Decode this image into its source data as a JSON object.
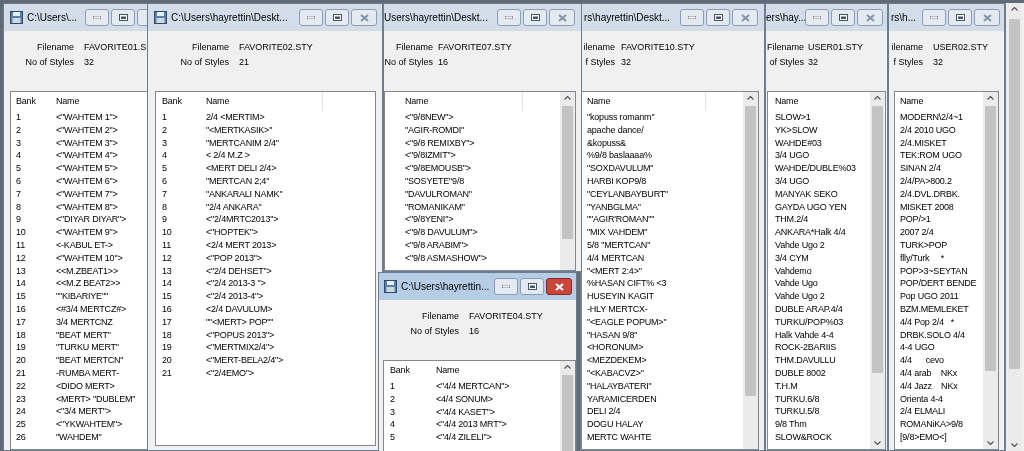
{
  "windows": [
    {
      "title": "C:\\Users\\...",
      "active": false,
      "filename_label": "Filename",
      "filename": "FAVORITE01.S",
      "styles_label": "No of Styles",
      "styles": "32",
      "columns": [
        "Bank",
        "Name"
      ],
      "rows": [
        [
          "1",
          "<\"WAHTEM 1\">"
        ],
        [
          "2",
          "<\"WAHTEM 2\">"
        ],
        [
          "3",
          "<\"WAHTEM 3\">"
        ],
        [
          "4",
          "<\"WAHTEM 4\">"
        ],
        [
          "5",
          "<\"WAHTEM 5\">"
        ],
        [
          "6",
          "<\"WAHTEM 6\">"
        ],
        [
          "7",
          "<\"WAHTEM 7\">"
        ],
        [
          "8",
          "<\"WAHTEM 8\">"
        ],
        [
          "9",
          "<\"DIYAR DIYAR\">"
        ],
        [
          "10",
          "<\"WAHTEM 9\">"
        ],
        [
          "11",
          "<-KABUL ET->"
        ],
        [
          "12",
          "<\"WAHTEM 10\">"
        ],
        [
          "13",
          "<<M.ZBEAT1>>"
        ],
        [
          "14",
          "<<M.Z BEAT2>>"
        ],
        [
          "15",
          "\"\"KIBARIYE\"\""
        ],
        [
          "16",
          "<#3/4 MERTCZ#>"
        ],
        [
          "17",
          "3/4 MERTCNZ"
        ],
        [
          "18",
          "\"BEAT MERT\""
        ],
        [
          "19",
          "\"TURKU MERT\""
        ],
        [
          "20",
          "\"BEAT MERTCN\""
        ],
        [
          "21",
          "-RUMBA MERT-"
        ],
        [
          "22",
          "<DIDO MERT>"
        ],
        [
          "23",
          "<MERT> \"DUBLEM\""
        ],
        [
          "24",
          "<\"3/4 MERT\">"
        ],
        [
          "25",
          "<\"YKWAHTEM\">"
        ],
        [
          "26",
          "\"WAHDEM\""
        ]
      ]
    },
    {
      "title": "C:\\Users\\hayrettin\\Deskt...",
      "active": false,
      "filename_label": "Filename",
      "filename": "FAVORITE02.STY",
      "styles_label": "No of Styles",
      "styles": "21",
      "columns": [
        "Bank",
        "Name"
      ],
      "rows": [
        [
          "1",
          "2/4 <MERTIM>"
        ],
        [
          "2",
          "\"<MERTKASIK>\""
        ],
        [
          "3",
          "\"MERTCANIM 2/4\""
        ],
        [
          "4",
          "< 2/4 M.Z >"
        ],
        [
          "5",
          "<MERT DELI 2/4>"
        ],
        [
          "6",
          "\"MERTCAN 2;4\""
        ],
        [
          "7",
          "\"ANKARALI NAMK\""
        ],
        [
          "8",
          "\"2/4 ANKARA\""
        ],
        [
          "9",
          "<\"2/4MRTC2013\">"
        ],
        [
          "10",
          "<\"HOPTEK\">"
        ],
        [
          "11",
          "<2/4 MERT 2013>"
        ],
        [
          "12",
          "<\"POP 2013\">"
        ],
        [
          "13",
          "<\"2/4 DEHSET\">"
        ],
        [
          "14",
          "<\"2/4 2013-3 \">"
        ],
        [
          "15",
          "<\"2/4 2013-4\">"
        ],
        [
          "16",
          "<2/4 DAVULUM>"
        ],
        [
          "17",
          "\"\"<MERT> POP\"\""
        ],
        [
          "18",
          "<\"POPUS 2013\">"
        ],
        [
          "19",
          "<\"MERTMIX2/4\">"
        ],
        [
          "20",
          "<\"MERT-BELA2/4\">"
        ],
        [
          "21",
          "<\"2/4EMO\">"
        ]
      ]
    },
    {
      "title": "Users\\hayrettin\\Deskt...",
      "active": false,
      "filename_label": "Filename",
      "filename": "FAVORITE07.STY",
      "styles_label": "No of Styles",
      "styles": "16",
      "columns": [
        "Name"
      ],
      "rows": [
        [
          "<\"9/8NEW\">"
        ],
        [
          "\"AGIR-ROMDI\""
        ],
        [
          "<\"9/8 REMIXBY\">"
        ],
        [
          "<\"9/8IZMIT\">"
        ],
        [
          "<\"9/8EMOUSB\">"
        ],
        [
          "\"SOSYETE\"9/8"
        ],
        [
          "\"DAVULROMAN\""
        ],
        [
          "\"ROMANIKAM\""
        ],
        [
          "<\"9/8YENI\">"
        ],
        [
          "<\"9/8 DAVULUM\">"
        ],
        [
          "<\"9/8 ARABIM\">"
        ],
        [
          "<\"9/8 ASMASHOW\">"
        ]
      ]
    },
    {
      "title": "C:\\Users\\hayrettin...",
      "active": true,
      "filename_label": "Filename",
      "filename": "FAVORITE04.STY",
      "styles_label": "No of Styles",
      "styles": "16",
      "columns": [
        "Bank",
        "Name"
      ],
      "rows": [
        [
          "1",
          "<\"4/4 MERTCAN\">"
        ],
        [
          "2",
          "<4/4 SONUM>"
        ],
        [
          "3",
          "<\"4/4 KASET\">"
        ],
        [
          "4",
          "<\"4/4 2013 MRT\">"
        ],
        [
          "5",
          "<\"4/4 ZILELI\">"
        ]
      ]
    },
    {
      "title": "rs\\hayrettin\\Deskt...",
      "active": false,
      "filename_label": "ilename",
      "filename": "FAVORITE10.STY",
      "styles_label": "f Styles",
      "styles": "32",
      "columns": [
        "Name"
      ],
      "rows": [
        [
          "\"kopuss romanm\""
        ],
        [
          "apache dance/"
        ],
        [
          "&kopuss&"
        ],
        [
          "%9/8 baslaaaa%"
        ],
        [
          "\"SOXDAVULUM\""
        ],
        [
          "HARBI KOP9/8"
        ],
        [
          "\"CEYLANBAYBURT\""
        ],
        [
          "\"YANBGLMA\""
        ],
        [
          "\"\"AGIR'ROMAN\"\""
        ],
        [
          "\"MIX VAHDEM\""
        ],
        [
          "5/8 \"MERTCAN\""
        ],
        [
          "4/4 MERTCAN"
        ],
        [
          "\"<MERT 2:4>\""
        ],
        [
          "%HASAN CIFT% <3"
        ],
        [
          "HUSEYIN KAGIT"
        ],
        [
          "-HLY MERTCX-"
        ],
        [
          "\"<EAGLE POPUM>\""
        ],
        [
          "\"HASAN 9/8\""
        ],
        [
          "<HORONUM>"
        ],
        [
          "<MEZDEKEM>"
        ],
        [
          "\"<KABACVZ>\""
        ],
        [
          "\"HALAYBATERI\""
        ],
        [
          "YARAMICERDEN"
        ],
        [
          "DELI 2/4"
        ],
        [
          "DOGU HALAY"
        ],
        [
          "MERTC WAHTE"
        ]
      ]
    },
    {
      "title": "ers\\hay...",
      "active": false,
      "filename_label": "Filename",
      "filename": "USER01.STY",
      "styles_label": "of Styles",
      "styles": "32",
      "columns": [
        "Name"
      ],
      "rows": [
        [
          "SLOW>1"
        ],
        [
          "YK>SLOW"
        ],
        [
          "WAHDE#03"
        ],
        [
          "3/4 UGO"
        ],
        [
          "WAHDE/DUBLE%03"
        ],
        [
          "3/4 UGO"
        ],
        [
          "MANYAK SEKO"
        ],
        [
          "GAYDA UGO YEN"
        ],
        [
          "THM.2/4"
        ],
        [
          "ANKARA*Halk 4/4"
        ],
        [
          "Vahde Ugo 2"
        ],
        [
          "3/4 CYM"
        ],
        [
          "Vahdemo"
        ],
        [
          "Vahde Ugo"
        ],
        [
          "Vahde Ugo 2"
        ],
        [
          "DUBLE ARAP.4/4"
        ],
        [
          "TURKU/POP%03"
        ],
        [
          "Halk Vahde 4-4"
        ],
        [
          "ROCK-2BARIIS"
        ],
        [
          "THM.DAVULLU"
        ],
        [
          "DUBLE 8002"
        ],
        [
          "T.H.M"
        ],
        [
          "TURKU.6/8"
        ],
        [
          "TURKU.5/8"
        ],
        [
          "9/8 Thm"
        ],
        [
          "SLOW&ROCK"
        ]
      ]
    },
    {
      "title": "rs\\h...",
      "active": false,
      "filename_label": "ilename",
      "filename": "USER02.STY",
      "styles_label": "f Styles",
      "styles": "32",
      "columns": [
        "Name"
      ],
      "rows": [
        [
          "MODERN\\2/4~1"
        ],
        [
          "2/4 2010 UGO"
        ],
        [
          "2/4.MISKET"
        ],
        [
          "TEK:ROM UGO"
        ],
        [
          "SINAN 2/4"
        ],
        [
          "2/4/PA>800.2"
        ],
        [
          "2/4.DVL.DRBK."
        ],
        [
          "MISKET 2008"
        ],
        [
          "POP/>1"
        ],
        [
          "2007 2/4"
        ],
        [
          "TURK>POP"
        ],
        [
          "flly/Turk     *"
        ],
        [
          "POP>3~SEYTAN"
        ],
        [
          "POP/DERT BENDE"
        ],
        [
          "Pop UGO 2011"
        ],
        [
          "BZM.MEMLEKET"
        ],
        [
          "4/4 Pop 2/4   *"
        ],
        [
          "DRBK.SOLO 4/4"
        ],
        [
          "4-4 UGO"
        ],
        [
          "4/4      cevo"
        ],
        [
          "4/4 arab    NKx"
        ],
        [
          "4/4 Jazz    NKx"
        ],
        [
          "Orienta 4-4"
        ],
        [
          "2/4 ELMALI"
        ],
        [
          "ROMANiKA>9/8"
        ],
        [
          "[9/8>EMO<]"
        ]
      ]
    }
  ]
}
